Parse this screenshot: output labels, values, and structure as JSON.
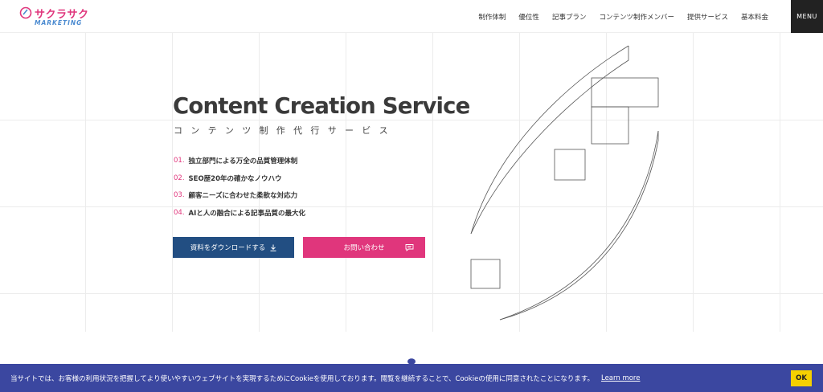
{
  "brand": {
    "name": "サクラサク",
    "sub": "MARKETING",
    "primary_color": "#e0367c",
    "secondary_color": "#224e82"
  },
  "nav": {
    "items": [
      "制作体制",
      "優位性",
      "記事プラン",
      "コンテンツ制作メンバー",
      "提供サービス",
      "基本料金"
    ],
    "menu_label": "MENU"
  },
  "hero": {
    "title": "Content Creation Service",
    "subtitle": "コンテンツ制作代行サービス",
    "features": [
      {
        "num": "01.",
        "text": "独立部門による万全の品質管理体制"
      },
      {
        "num": "02.",
        "text": "SEO歴20年の確かなノウハウ"
      },
      {
        "num": "03.",
        "text": "顧客ニーズに合わせた柔軟な対応力"
      },
      {
        "num": "04.",
        "text": "AIと人の融合による記事品質の最大化"
      }
    ],
    "download_label": "資料をダウンロードする",
    "contact_label": "お問い合わせ"
  },
  "cookie": {
    "text": "当サイトでは、お客様の利用状況を把握してより使いやすいウェブサイトを実現するためにCookieを使用しております。閲覧を継続することで、Cookieの使用に同意されたことになります。",
    "link": "Learn more",
    "ok": "OK",
    "bg_color": "#3b47a0"
  }
}
